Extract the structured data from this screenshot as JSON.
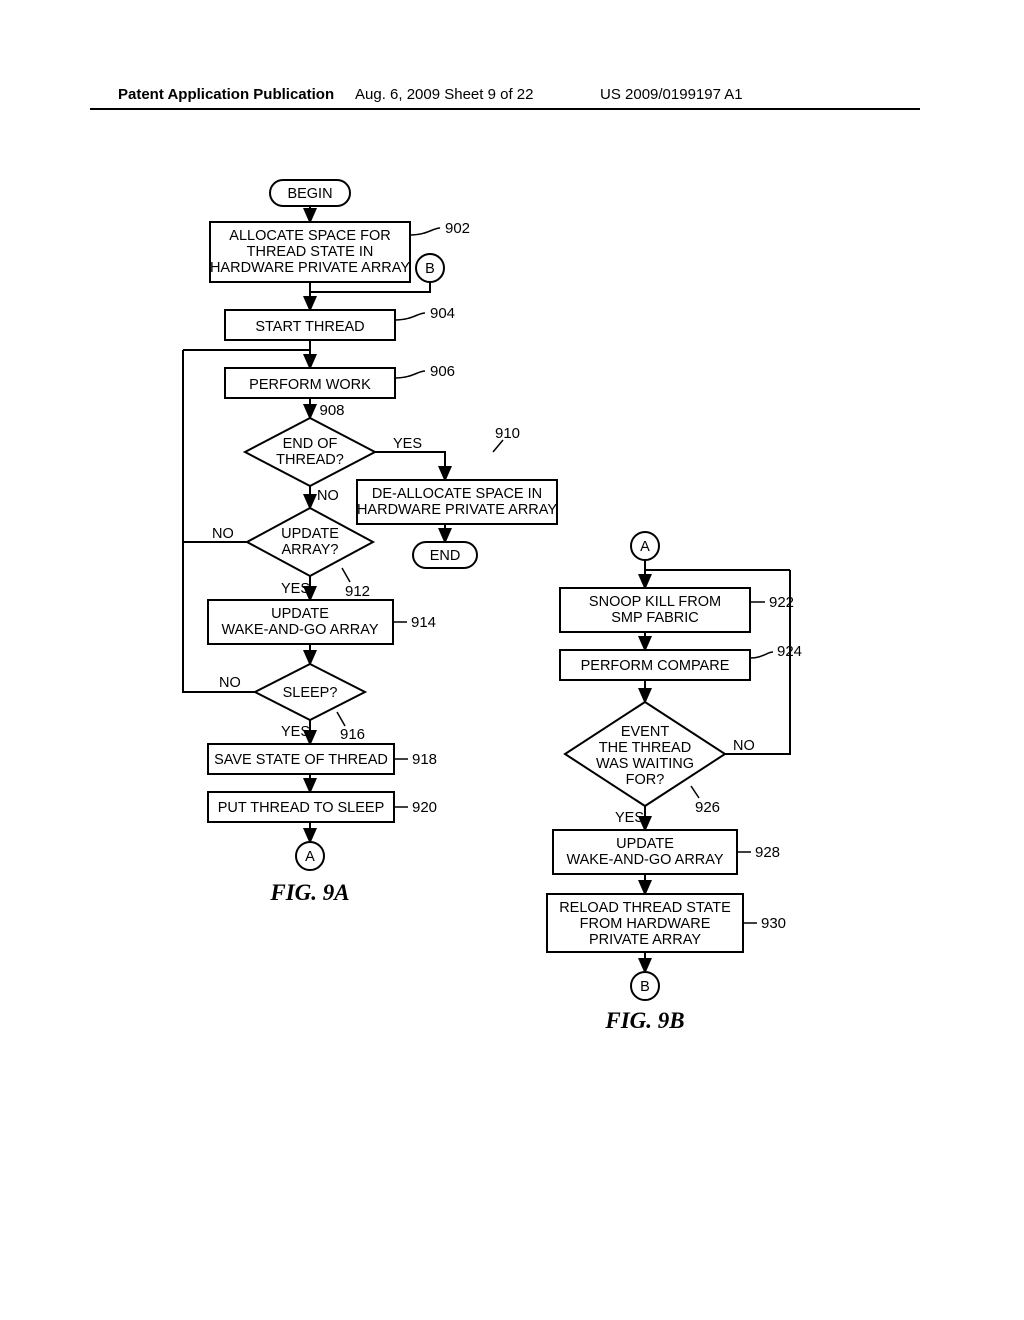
{
  "header": {
    "left": "Patent Application Publication",
    "mid": "Aug. 6, 2009   Sheet 9 of 22",
    "right": "US 2009/0199197 A1"
  },
  "fig9a": {
    "caption": "FIG. 9A",
    "begin": "BEGIN",
    "n902": "ALLOCATE SPACE FOR THREAD STATE IN HARDWARE PRIVATE ARRAY",
    "l902": "902",
    "B": "B",
    "n904": "START THREAD",
    "l904": "904",
    "n906": "PERFORM WORK",
    "l906": "906",
    "n908": "END OF THREAD?",
    "l908": "908",
    "yes908": "YES",
    "no908": "NO",
    "n910": "DE-ALLOCATE SPACE IN HARDWARE PRIVATE ARRAY",
    "l910": "910",
    "end": "END",
    "n912": "UPDATE ARRAY?",
    "l912": "912",
    "yes912": "YES",
    "no912": "NO",
    "n914": "UPDATE WAKE-AND-GO ARRAY",
    "l914": "914",
    "n916": "SLEEP?",
    "l916": "916",
    "yes916": "YES",
    "no916": "NO",
    "n918": "SAVE STATE OF THREAD",
    "l918": "918",
    "n920": "PUT THREAD TO SLEEP",
    "l920": "920",
    "A": "A"
  },
  "fig9b": {
    "caption": "FIG. 9B",
    "A": "A",
    "n922": "SNOOP KILL FROM SMP FABRIC",
    "l922": "922",
    "n924": "PERFORM COMPARE",
    "l924": "924",
    "n926": "EVENT THE THREAD WAS WAITING FOR?",
    "l926": "926",
    "yes926": "YES",
    "no926": "NO",
    "n928": "UPDATE WAKE-AND-GO ARRAY",
    "l928": "928",
    "n930": "RELOAD THREAD STATE FROM HARDWARE PRIVATE ARRAY",
    "l930": "930",
    "B": "B"
  },
  "chart_data": {
    "type": "flowchart",
    "title": "Thread Wake-and-Go Array Flowcharts (FIG. 9A and FIG. 9B)",
    "figures": [
      {
        "id": "FIG. 9A",
        "nodes": [
          {
            "id": "begin",
            "type": "terminator",
            "label": "BEGIN"
          },
          {
            "id": "902",
            "type": "process",
            "label": "ALLOCATE SPACE FOR THREAD STATE IN HARDWARE PRIVATE ARRAY"
          },
          {
            "id": "B_in",
            "type": "connector",
            "label": "B"
          },
          {
            "id": "904",
            "type": "process",
            "label": "START THREAD"
          },
          {
            "id": "906",
            "type": "process",
            "label": "PERFORM WORK"
          },
          {
            "id": "908",
            "type": "decision",
            "label": "END OF THREAD?"
          },
          {
            "id": "910",
            "type": "process",
            "label": "DE-ALLOCATE SPACE IN HARDWARE PRIVATE ARRAY"
          },
          {
            "id": "end",
            "type": "terminator",
            "label": "END"
          },
          {
            "id": "912",
            "type": "decision",
            "label": "UPDATE ARRAY?"
          },
          {
            "id": "914",
            "type": "process",
            "label": "UPDATE WAKE-AND-GO ARRAY"
          },
          {
            "id": "916",
            "type": "decision",
            "label": "SLEEP?"
          },
          {
            "id": "918",
            "type": "process",
            "label": "SAVE STATE OF THREAD"
          },
          {
            "id": "920",
            "type": "process",
            "label": "PUT THREAD TO SLEEP"
          },
          {
            "id": "A_out",
            "type": "connector",
            "label": "A"
          }
        ],
        "edges": [
          {
            "from": "begin",
            "to": "902"
          },
          {
            "from": "902",
            "to": "904"
          },
          {
            "from": "B_in",
            "to": "904"
          },
          {
            "from": "904",
            "to": "906"
          },
          {
            "from": "906",
            "to": "908"
          },
          {
            "from": "908",
            "to": "910",
            "label": "YES"
          },
          {
            "from": "910",
            "to": "end"
          },
          {
            "from": "908",
            "to": "912",
            "label": "NO"
          },
          {
            "from": "912",
            "to": "906",
            "label": "NO"
          },
          {
            "from": "912",
            "to": "914",
            "label": "YES"
          },
          {
            "from": "914",
            "to": "916"
          },
          {
            "from": "916",
            "to": "906",
            "label": "NO"
          },
          {
            "from": "916",
            "to": "918",
            "label": "YES"
          },
          {
            "from": "918",
            "to": "920"
          },
          {
            "from": "920",
            "to": "A_out"
          }
        ]
      },
      {
        "id": "FIG. 9B",
        "nodes": [
          {
            "id": "A_in",
            "type": "connector",
            "label": "A"
          },
          {
            "id": "922",
            "type": "process",
            "label": "SNOOP KILL FROM SMP FABRIC"
          },
          {
            "id": "924",
            "type": "process",
            "label": "PERFORM COMPARE"
          },
          {
            "id": "926",
            "type": "decision",
            "label": "EVENT THE THREAD WAS WAITING FOR?"
          },
          {
            "id": "928",
            "type": "process",
            "label": "UPDATE WAKE-AND-GO ARRAY"
          },
          {
            "id": "930",
            "type": "process",
            "label": "RELOAD THREAD STATE FROM HARDWARE PRIVATE ARRAY"
          },
          {
            "id": "B_out",
            "type": "connector",
            "label": "B"
          }
        ],
        "edges": [
          {
            "from": "A_in",
            "to": "922"
          },
          {
            "from": "922",
            "to": "924"
          },
          {
            "from": "924",
            "to": "926"
          },
          {
            "from": "926",
            "to": "922",
            "label": "NO"
          },
          {
            "from": "926",
            "to": "928",
            "label": "YES"
          },
          {
            "from": "928",
            "to": "930"
          },
          {
            "from": "930",
            "to": "B_out"
          }
        ]
      }
    ]
  }
}
